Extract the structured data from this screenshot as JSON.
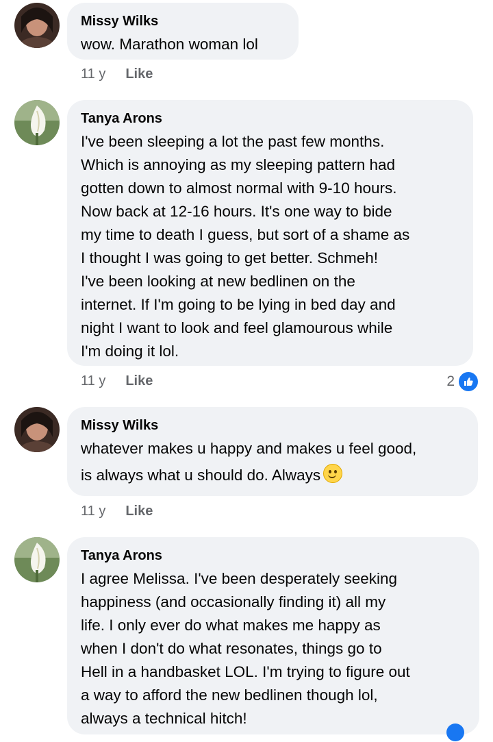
{
  "colors": {
    "bubble": "#f0f2f5",
    "meta": "#65676b",
    "reaction": "#1877f2"
  },
  "comments": [
    {
      "author": "Missy Wilks",
      "lines": [
        "wow. Marathon woman lol"
      ],
      "time": "11 y",
      "like": "Like"
    },
    {
      "author": "Tanya Arons",
      "lines": [
        "I've been sleeping a lot the past few months.",
        "Which is annoying as my sleeping pattern had",
        "gotten down to almost normal with 9-10 hours.",
        "Now back at 12-16 hours.  It's one way to bide",
        "my time to death I guess, but sort of a shame as",
        "I thought I was going to get better.  Schmeh!",
        "I've been looking at new bedlinen on the",
        "internet.  If I'm going to be lying in bed day and",
        "night I want to look and feel glamourous while",
        "I'm doing it lol."
      ],
      "time": "11 y",
      "like": "Like",
      "reaction_count": "2"
    },
    {
      "author": "Missy Wilks",
      "lines": [
        "whatever makes u happy and makes u feel good,",
        "is always what u should do. Always"
      ],
      "emoji": "slightly-smiling-face-icon",
      "time": "11 y",
      "like": "Like"
    },
    {
      "author": "Tanya Arons",
      "lines": [
        "I agree Melissa.  I've been desperately seeking",
        "happiness (and occasionally finding it) all my",
        "life.  I only ever do what makes me happy as",
        "when I don't do what resonates, things go to",
        "Hell in a handbasket LOL.  I'm trying to figure out",
        "a way to afford the new bedlinen though lol,",
        "always a technical hitch!"
      ]
    }
  ]
}
